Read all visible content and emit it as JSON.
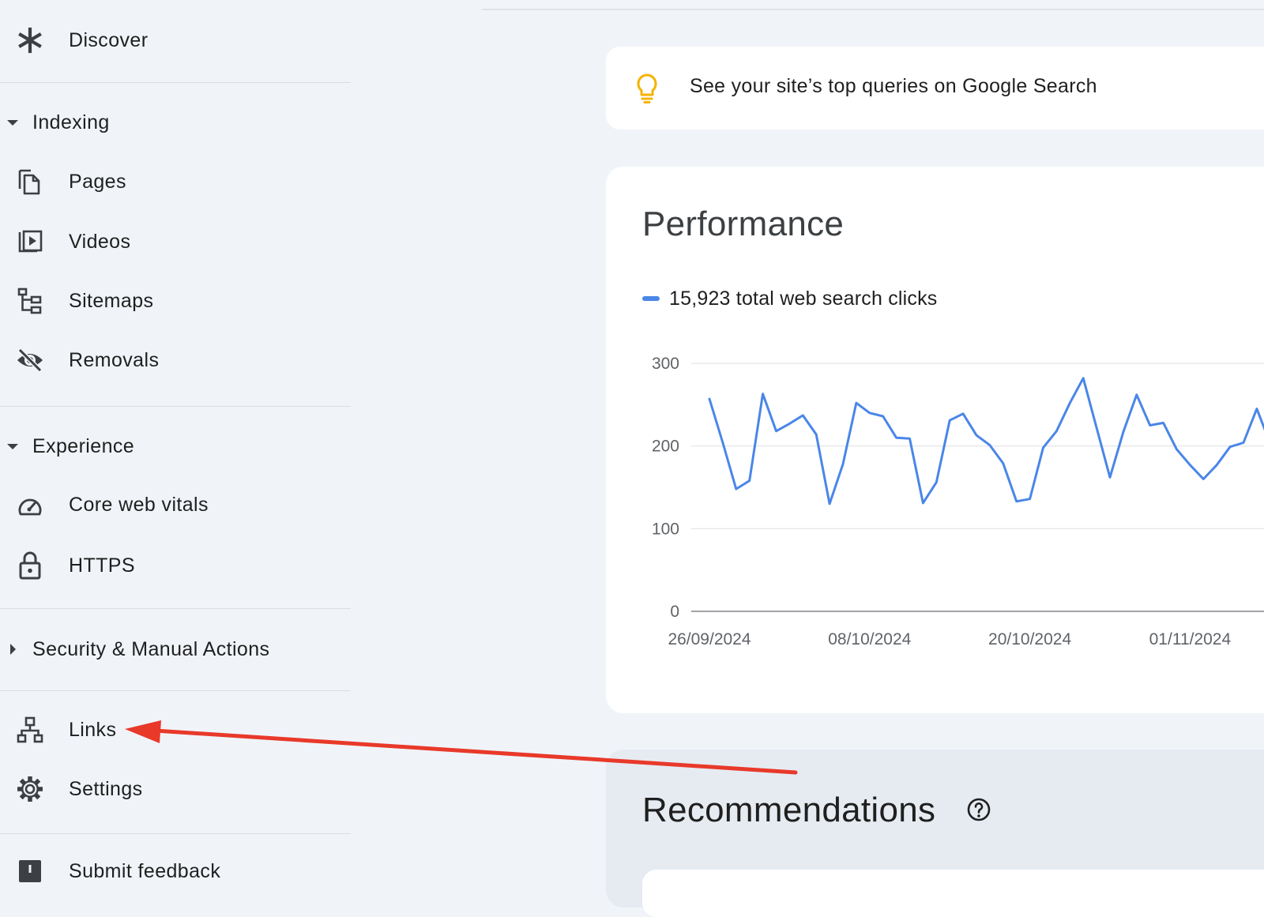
{
  "sidebar": {
    "top_item": {
      "label": "Discover",
      "icon": "asterisk-icon"
    },
    "sections": [
      {
        "title": "Indexing",
        "expanded": true,
        "items": [
          {
            "label": "Pages",
            "icon": "pages-icon"
          },
          {
            "label": "Videos",
            "icon": "video-icon"
          },
          {
            "label": "Sitemaps",
            "icon": "sitemap-icon"
          },
          {
            "label": "Removals",
            "icon": "eye-off-icon"
          }
        ]
      },
      {
        "title": "Experience",
        "expanded": true,
        "items": [
          {
            "label": "Core web vitals",
            "icon": "gauge-icon"
          },
          {
            "label": "HTTPS",
            "icon": "lock-icon"
          }
        ]
      },
      {
        "title": "Security & Manual Actions",
        "expanded": false,
        "items": []
      }
    ],
    "bottom_items": [
      {
        "label": "Links",
        "icon": "links-icon"
      },
      {
        "label": "Settings",
        "icon": "gear-icon"
      }
    ],
    "footer_item": {
      "label": "Submit feedback",
      "icon": "feedback-icon"
    }
  },
  "tip": {
    "text": "See your site’s top queries on Google Search",
    "icon": "lightbulb-icon",
    "icon_color": "#f4b400"
  },
  "performance": {
    "title": "Performance",
    "legend_text": "15,923 total web search clicks",
    "series_color": "#4a86e8"
  },
  "chart_data": {
    "type": "line",
    "title": "Performance",
    "xlabel": "",
    "ylabel": "",
    "ylim": [
      0,
      300
    ],
    "yticks": [
      0,
      100,
      200,
      300
    ],
    "x_tick_labels": [
      "26/09/2024",
      "08/10/2024",
      "20/10/2024",
      "01/11/2024"
    ],
    "x_start": "26/09/2024",
    "grid": true,
    "series": [
      {
        "name": "15,923 total web search clicks",
        "color": "#4a86e8",
        "values": [
          257,
          204,
          148,
          158,
          263,
          218,
          227,
          237,
          214,
          130,
          178,
          252,
          240,
          236,
          210,
          209,
          131,
          156,
          231,
          239,
          213,
          201,
          179,
          133,
          136,
          198,
          218,
          252,
          282,
          222,
          162,
          217,
          262,
          225,
          228,
          196,
          177,
          160,
          177,
          199,
          204,
          245,
          203
        ]
      }
    ]
  },
  "recommendations": {
    "title": "Recommendations",
    "help_icon": "help-circle-icon"
  },
  "annotation": {
    "color": "#e8392a"
  }
}
